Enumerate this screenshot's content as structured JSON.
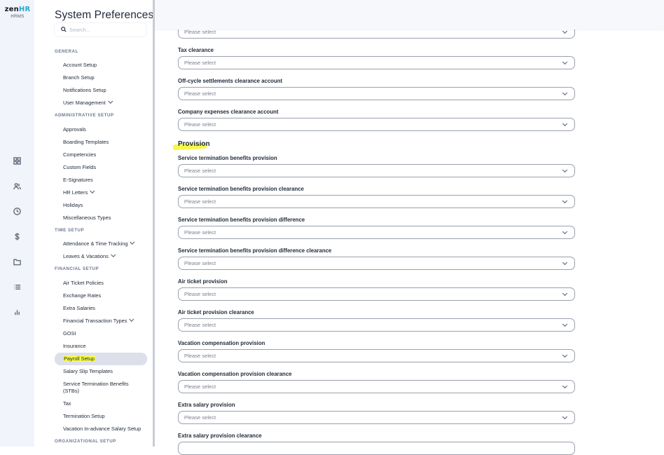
{
  "app": {
    "logo_main_1": "zen",
    "logo_main_2": "HR",
    "logo_sub": "HRMS"
  },
  "rail_icons": [
    "dashboard-icon",
    "users-icon",
    "clock-icon",
    "dollar-icon",
    "folder-icon",
    "list-icon",
    "chart-icon"
  ],
  "nav": {
    "title": "System Preferences",
    "search_placeholder": "Search...",
    "sections": {
      "general": "GENERAL",
      "admin": "ADMINISTRATIVE SETUP",
      "time": "TIME SETUP",
      "financial": "FINANCIAL SETUP",
      "org": "ORGANIZATIONAL SETUP"
    },
    "items": {
      "account_setup": "Account Setup",
      "branch_setup": "Branch Setup",
      "notifications_setup": "Notifications Setup",
      "user_management": "User Management",
      "approvals": "Approvals",
      "boarding_templates": "Boarding Templates",
      "competencies": "Competencies",
      "custom_fields": "Custom Fields",
      "e_signatures": "E-Signatures",
      "hr_letters": "HR Letters",
      "holidays": "Holidays",
      "misc_types": "Miscellaneous Types",
      "attendance": "Attendance & Time Tracking",
      "leaves": "Leaves & Vacations",
      "air_ticket_policies": "Air Ticket Policies",
      "exchange_rates": "Exchange Rates",
      "extra_salaries": "Extra Salaries",
      "financial_transaction_types": "Financial Transaction Types",
      "gosi": "GOSI",
      "insurance": "Insurance",
      "payroll_setup": "Payroll Setup",
      "salary_slip_templates": "Salary Slip Templates",
      "stbs": "Service Termination Benefits (STBs)",
      "tax": "Tax",
      "termination_setup": "Termination Setup",
      "vacation_salary": "Vacation In-advance Salary Setup"
    }
  },
  "form": {
    "placeholder": "Please select",
    "section_provision": "Provision",
    "fields": [
      "Tax clearance",
      "Off-cycle settlements clearance account",
      "Company expenses clearance account",
      "Service termination benefits provision",
      "Service termination benefits provision clearance",
      "Service termination benefits provision difference",
      "Service termination benefits provision difference clearance",
      "Air ticket provision",
      "Air ticket provision clearance",
      "Vacation compensation provision",
      "Vacation compensation provision clearance",
      "Extra salary provision",
      "Extra salary provision clearance"
    ]
  },
  "colors": {
    "highlight": "#f6f94a",
    "active_item_bg": "#dde0ea",
    "logo_accent": "#2aa7c9"
  }
}
